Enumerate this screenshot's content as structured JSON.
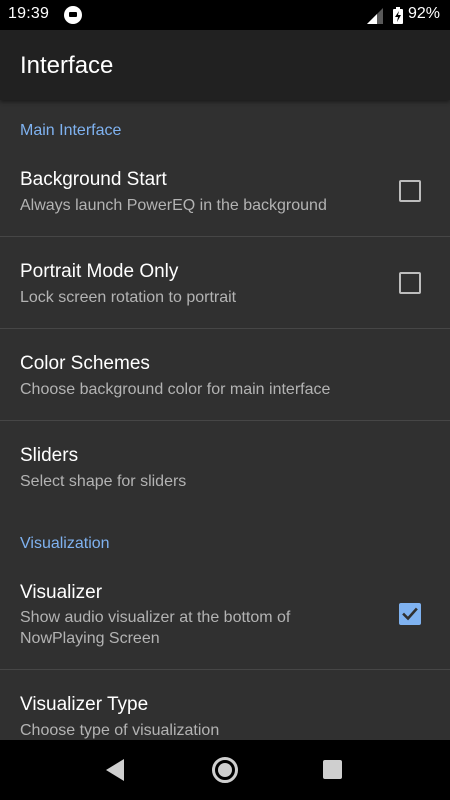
{
  "status_bar": {
    "time": "19:39",
    "battery_percent": "92%",
    "notification_icon": "app-notification-icon",
    "signal_icon": "cell-signal-icon",
    "battery_icon": "battery-charging-icon"
  },
  "app_bar": {
    "title": "Interface"
  },
  "sections": [
    {
      "header": "Main Interface",
      "items": [
        {
          "title": "Background Start",
          "summary": "Always launch PowerEQ in the background",
          "checkbox": true,
          "checked": false
        },
        {
          "title": "Portrait Mode Only",
          "summary": "Lock screen rotation to portrait",
          "checkbox": true,
          "checked": false
        },
        {
          "title": "Color Schemes",
          "summary": "Choose background color for main interface",
          "checkbox": false
        },
        {
          "title": "Sliders",
          "summary": "Select shape for sliders",
          "checkbox": false
        }
      ]
    },
    {
      "header": "Visualization",
      "items": [
        {
          "title": "Visualizer",
          "summary": "Show audio visualizer at the bottom of NowPlaying Screen",
          "checkbox": true,
          "checked": true
        },
        {
          "title": "Visualizer Type",
          "summary": "Choose type of visualization",
          "checkbox": false
        }
      ]
    }
  ],
  "nav_bar": {
    "back_icon": "back-triangle-icon",
    "home_icon": "home-circle-icon",
    "recents_icon": "recents-square-icon"
  },
  "colors": {
    "accent": "#7fb2f0",
    "background": "#303030",
    "app_bar": "#212121",
    "divider": "#464646"
  }
}
